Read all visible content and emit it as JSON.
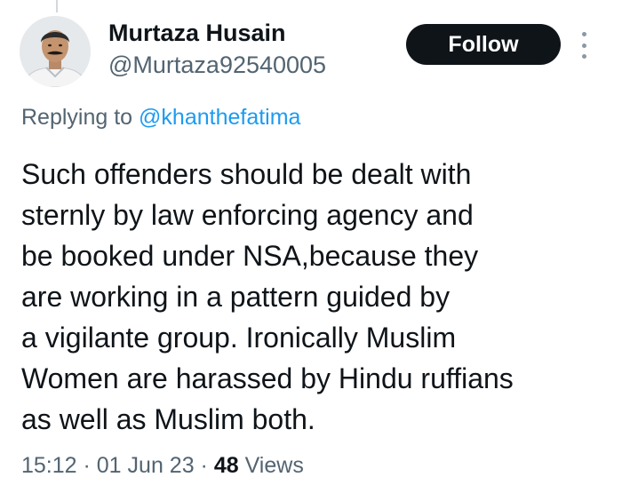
{
  "author": {
    "display_name": "Murtaza Husain",
    "handle": "@Murtaza92540005"
  },
  "actions": {
    "follow_label": "Follow",
    "more_icon": "more-dots-vertical-icon"
  },
  "reply_context": {
    "prefix": "Replying to ",
    "mention": "@khanthefatima"
  },
  "tweet": {
    "lines": [
      "Such offenders should be dealt with",
      "sternly by law enforcing agency and",
      "be booked under NSA,because they",
      "are working in a pattern guided by",
      "a vigilante group. Ironically Muslim",
      "Women are harassed by Hindu ruffians",
      "as well as Muslim both."
    ]
  },
  "meta": {
    "time": "15:12",
    "separator": " · ",
    "date": "01 Jun 23",
    "views_count": "48",
    "views_label": " Views"
  },
  "colors": {
    "text_primary": "#0f1419",
    "text_secondary": "#536471",
    "link": "#1d9bf0",
    "button_bg": "#0f1419",
    "button_text": "#ffffff"
  }
}
